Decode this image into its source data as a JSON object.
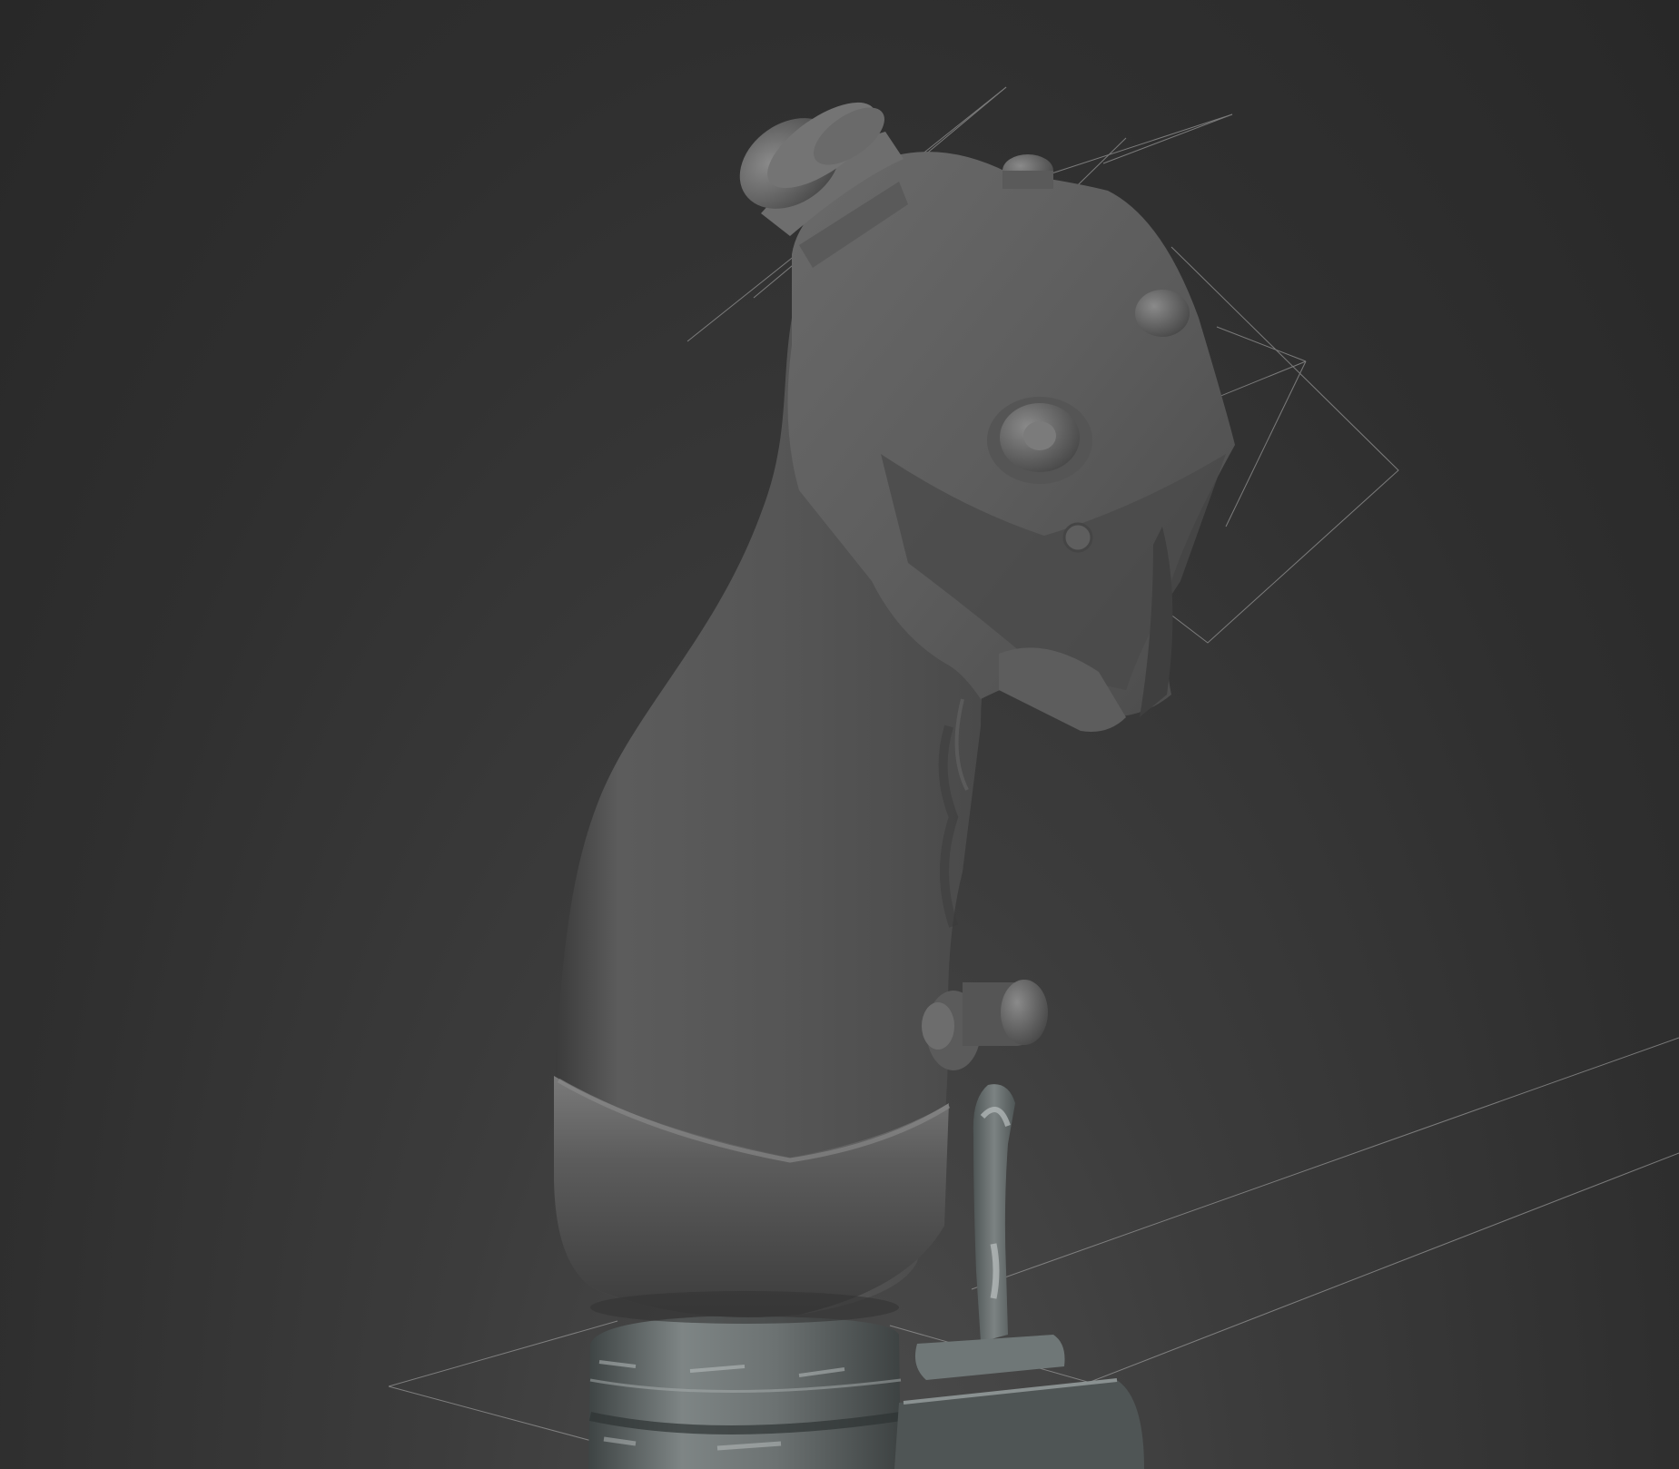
{
  "viewport": {
    "background_top": "#2b2b2b",
    "background_bottom": "#4a4a4a"
  },
  "model": {
    "material_grip": "#5a5a5a",
    "material_textured": "#6b7070",
    "wire_color": "#9a9a9a",
    "icons": [
      "grip-body",
      "top-button-cap",
      "hat-switch",
      "trigger-paddle",
      "side-pinky-button",
      "lever",
      "base-collar"
    ]
  }
}
